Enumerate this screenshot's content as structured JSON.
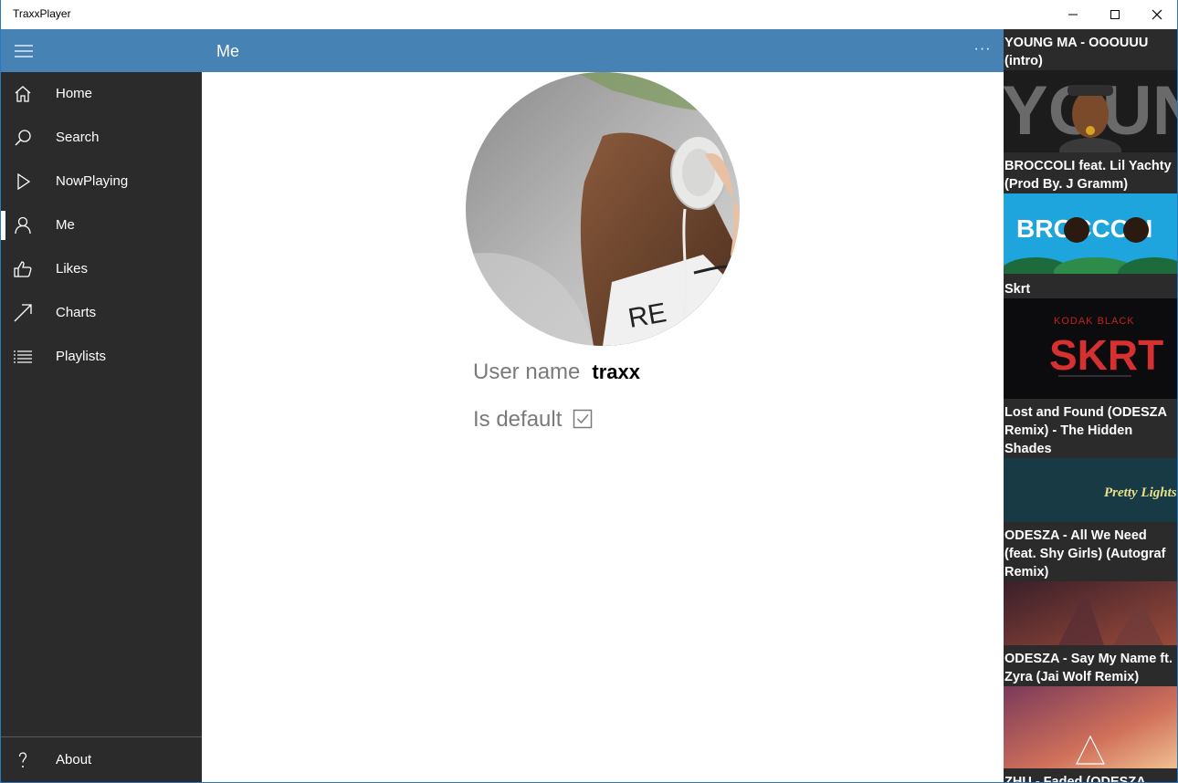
{
  "window": {
    "title": "TraxxPlayer"
  },
  "header": {
    "title": "Me",
    "more_label": "···"
  },
  "nav": {
    "items": [
      {
        "label": "Home",
        "icon": "home-icon"
      },
      {
        "label": "Search",
        "icon": "search-icon"
      },
      {
        "label": "NowPlaying",
        "icon": "play-icon"
      },
      {
        "label": "Me",
        "icon": "person-icon",
        "selected": true
      },
      {
        "label": "Likes",
        "icon": "thumbs-up-icon"
      },
      {
        "label": "Charts",
        "icon": "trend-arrow-icon"
      },
      {
        "label": "Playlists",
        "icon": "list-icon"
      }
    ],
    "footer": {
      "label": "About",
      "icon": "help-icon"
    }
  },
  "profile": {
    "user_label": "User name",
    "user_value": "traxx",
    "default_label": "Is default",
    "is_default": true
  },
  "tracks": [
    {
      "title": "YOUNG MA - OOOUUU (intro)",
      "art_text": "YOUNG"
    },
    {
      "title": "BROCCOLI feat. Lil Yachty (Prod By. J Gramm)",
      "art_text": "BROCCOLI"
    },
    {
      "title": "Skrt",
      "art_text": "SKRT"
    },
    {
      "title": "Lost and Found (ODESZA Remix) - The Hidden Shades",
      "art_text": "Pretty Lights"
    },
    {
      "title": "ODESZA - All We Need (feat. Shy Girls) (Autograf Remix)",
      "art_text": ""
    },
    {
      "title": "ODESZA - Say My Name ft. Zyra (Jai Wolf Remix)",
      "art_text": ""
    },
    {
      "title": "ZHU - Faded (ODESZA",
      "art_text": ""
    }
  ],
  "colors": {
    "accent": "#4682b4",
    "nav_bg": "#2b2b2b",
    "rail_bg": "#2b2b2b"
  }
}
